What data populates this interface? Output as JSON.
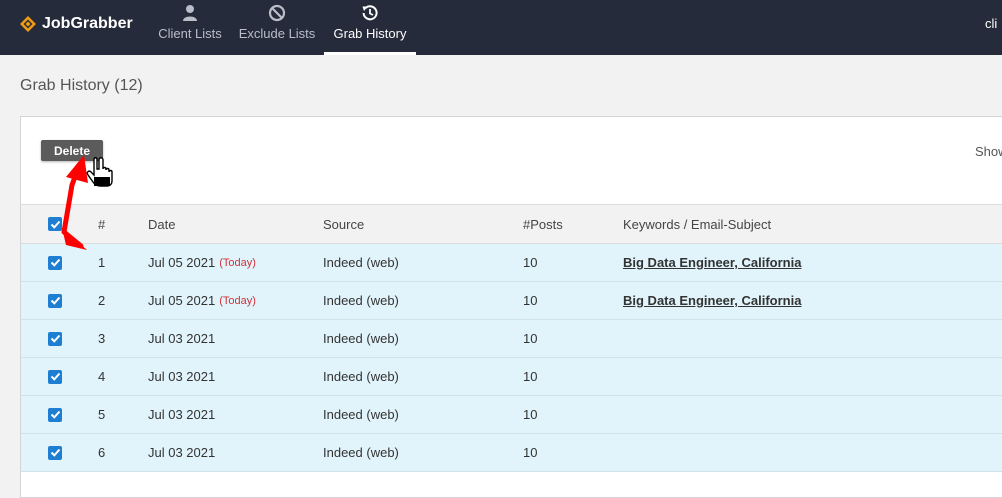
{
  "navbar": {
    "brand": "JobGrabber",
    "tabs": [
      {
        "label": "Client Lists",
        "icon": "user-icon"
      },
      {
        "label": "Exclude Lists",
        "icon": "ban-icon"
      },
      {
        "label": "Grab History",
        "icon": "history-icon",
        "active": true
      }
    ],
    "user": "cli"
  },
  "page": {
    "title": "Grab History (12)"
  },
  "toolbar": {
    "delete_label": "Delete",
    "show_label": "Show"
  },
  "table": {
    "headers": [
      "#",
      "Date",
      "Source",
      "#Posts",
      "Keywords / Email-Subject"
    ],
    "rows": [
      {
        "num": "1",
        "date": "Jul 05 2021",
        "today": "(Today)",
        "source": "Indeed (web)",
        "posts": "10",
        "keywords": "Big Data Engineer, California"
      },
      {
        "num": "2",
        "date": "Jul 05 2021",
        "today": "(Today)",
        "source": "Indeed (web)",
        "posts": "10",
        "keywords": "Big Data Engineer, California"
      },
      {
        "num": "3",
        "date": "Jul 03 2021",
        "today": "",
        "source": "Indeed (web)",
        "posts": "10",
        "keywords": ""
      },
      {
        "num": "4",
        "date": "Jul 03 2021",
        "today": "",
        "source": "Indeed (web)",
        "posts": "10",
        "keywords": ""
      },
      {
        "num": "5",
        "date": "Jul 03 2021",
        "today": "",
        "source": "Indeed (web)",
        "posts": "10",
        "keywords": ""
      },
      {
        "num": "6",
        "date": "Jul 03 2021",
        "today": "",
        "source": "Indeed (web)",
        "posts": "10",
        "keywords": ""
      }
    ]
  },
  "colors": {
    "navbar_bg": "#252b3a",
    "brand_accent": "#f39c12",
    "checkbox": "#1e7fd2",
    "row_selected_bg": "#e1f4fb",
    "today_text": "#d0333a",
    "annotation_arrow": "#ff0000"
  }
}
